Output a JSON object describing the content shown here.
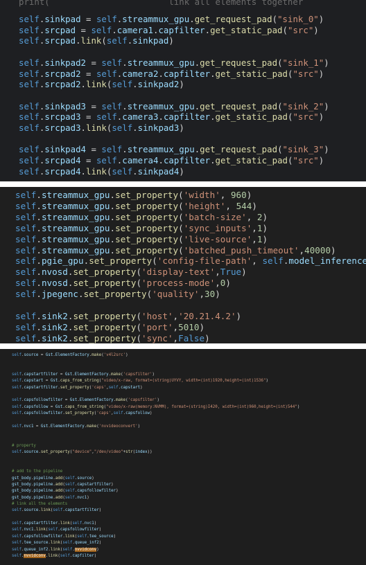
{
  "panel1": {
    "cut_text": "print(                       link all elements together",
    "lines": [
      "self.sinkpad = self.streammux_gpu.get_request_pad(\"sink_0\")",
      "self.srcpad = self.camera1.capfilter.get_static_pad(\"src\")",
      "self.srcpad.link(self.sinkpad)",
      "",
      "self.sinkpad2 = self.streammux_gpu.get_request_pad(\"sink_1\")",
      "self.srcpad2 = self.camera2.capfilter.get_static_pad(\"src\")",
      "self.srcpad2.link(self.sinkpad2)",
      "",
      "self.sinkpad3 = self.streammux_gpu.get_request_pad(\"sink_2\")",
      "self.srcpad3 = self.camera3.capfilter.get_static_pad(\"src\")",
      "self.srcpad3.link(self.sinkpad3)",
      "",
      "self.sinkpad4 = self.streammux_gpu.get_request_pad(\"sink_3\")",
      "self.srcpad4 = self.camera4.capfilter.get_static_pad(\"src\")",
      "self.srcpad4.link(self.sinkpad4)"
    ]
  },
  "panel2": {
    "lines": [
      "self.streammux_gpu.set_property('width', 960)",
      "self.streammux_gpu.set_property('height', 544)",
      "self.streammux_gpu.set_property('batch-size', 2)",
      "self.streammux_gpu.set_property('sync_inputs',1)",
      "self.streammux_gpu.set_property('live-source',1)",
      "self.streammux_gpu.set_property('batched_push_timeout',40000)",
      "self.pgie_gpu.set_property('config-file-path', self.model_inference)",
      "self.nvosd.set_property('display-text',True)",
      "self.nvosd.set_property('process-mode',0)",
      "self.jpegenc.set_property('quality',30)",
      "",
      "self.sink2.set_property('host','20.21.4.2')",
      "self.sink2.set_property('port',5010)",
      "self.sink2.set_property('sync',False)"
    ]
  },
  "panel3": {
    "lines": [
      "self.source = Gst.ElementFactory.make('v4l2src')",
      "",
      "",
      "self.capstartfilter = Gst.ElementFactory.make('capsfilter')",
      "self.capstart = Gst.caps_from_string(\"video/x-raw, format=(string)UYVY, width=(int)1920,height=(int)1536\")",
      "self.capstartfilter.set_property('caps',self.capstart)",
      "",
      "self.capsfollowfilter = Gst.ElementFactory.make('capsfilter')",
      "self.capsfollow = Gst.caps_from_string(\"video/x-raw(memory:NVMM), format=(string)I420, width=(int)960,height=(int)544\")",
      "self.capsfollowfilter.set_property('caps',self.capsfollow)",
      "",
      "self.nvc1 = Gst.ElementFactory.make('nvvideoconvert')",
      "",
      "",
      "# property",
      "self.source.set_property(\"device\",\"/dev/video\"+str(index))",
      "",
      "",
      "# add to the pipeline",
      "gst_body.pipeline.add(self.source)",
      "gst_body.pipeline.add(self.capstartfilter)",
      "gst_body.pipeline.add(self.capsfollowfilter)",
      "gst_body.pipeline.add(self.nvc1)",
      "# link all the elements",
      "self.source.link(self.capstartfilter)",
      "",
      "self.capstartfilter.link(self.nvc1)",
      "self.nvc1.link(self.capsfollowfilter)",
      "self.capsfollowfilter.link(self.tee_source)",
      "self.tee_source.link(self.queue_inf2)",
      "self.queue_inf2.link(self.nvvidconv)",
      "self.nvvidconv.link(self.capfilter)"
    ],
    "highlight_word": "nvvidconv"
  }
}
